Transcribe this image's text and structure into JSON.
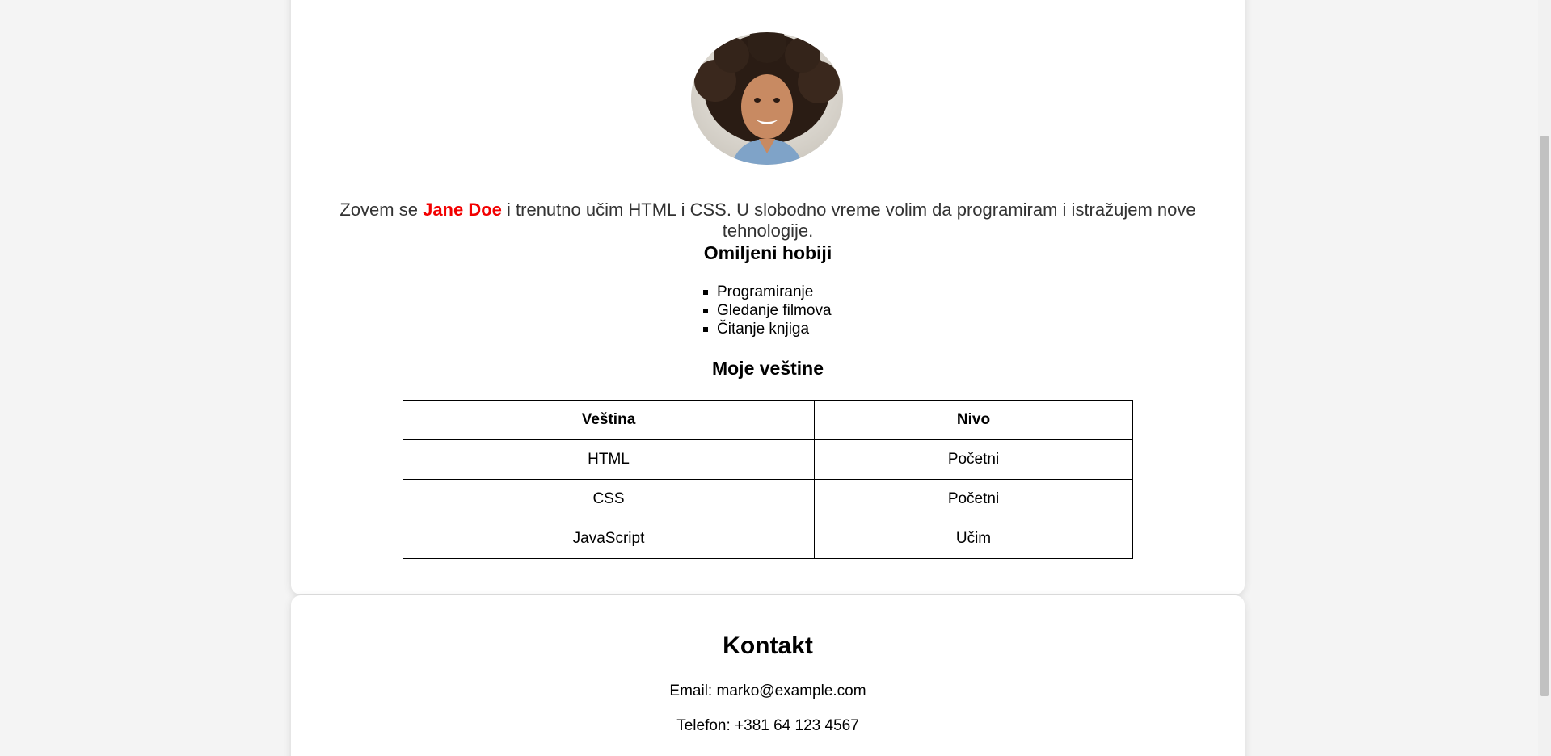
{
  "profile": {
    "intro_before": "Zovem se ",
    "name": "Jane Doe",
    "intro_after": " i trenutno učim HTML i CSS. U slobodno vreme volim da programiram i istražujem nove tehnologije.",
    "avatar_icon": "profile-photo"
  },
  "hobbies": {
    "title": "Omiljeni hobiji",
    "items": [
      "Programiranje",
      "Gledanje filmova",
      "Čitanje knjiga"
    ]
  },
  "skills": {
    "title": "Moje veštine",
    "headers": [
      "Veština",
      "Nivo"
    ],
    "rows": [
      [
        "HTML",
        "Početni"
      ],
      [
        "CSS",
        "Početni"
      ],
      [
        "JavaScript",
        "Učim"
      ]
    ]
  },
  "contact": {
    "title": "Kontakt",
    "email": "Email: marko@example.com",
    "phone": "Telefon: +381 64 123 4567"
  },
  "colors": {
    "name_accent": "#f20000",
    "page_background": "#f4f4f4",
    "card_background": "#ffffff"
  }
}
